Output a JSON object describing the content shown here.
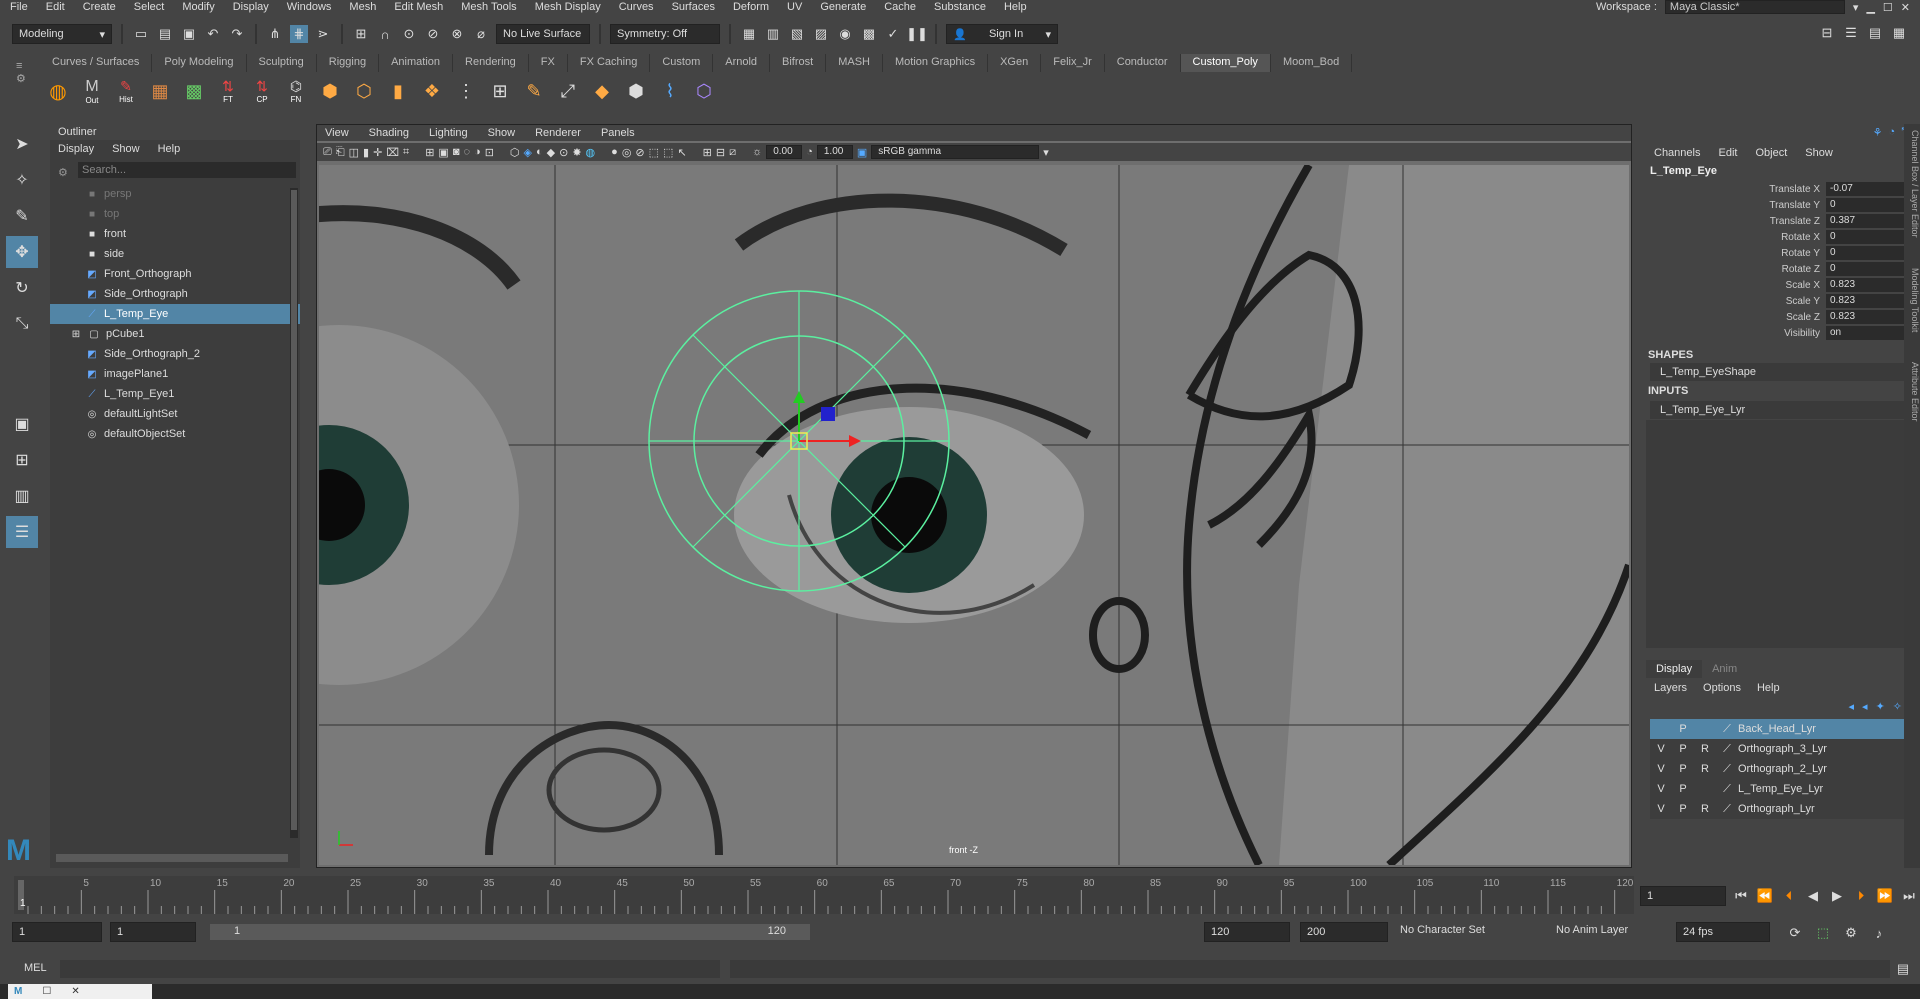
{
  "menubar": {
    "items": [
      "File",
      "Edit",
      "Create",
      "Select",
      "Modify",
      "Display",
      "Windows",
      "Mesh",
      "Edit Mesh",
      "Mesh Tools",
      "Mesh Display",
      "Curves",
      "Surfaces",
      "Deform",
      "UV",
      "Generate",
      "Cache",
      "Substance",
      "Help"
    ],
    "workspace_label": "Workspace :",
    "workspace_value": "Maya Classic*"
  },
  "statusline": {
    "mode": "Modeling",
    "live_surface": "No Live Surface",
    "symmetry": "Symmetry: Off",
    "sign_in": "Sign In"
  },
  "shelf": {
    "tabs": [
      "Curves / Surfaces",
      "Poly Modeling",
      "Sculpting",
      "Rigging",
      "Animation",
      "Rendering",
      "FX",
      "FX Caching",
      "Custom",
      "Arnold",
      "Bifrost",
      "MASH",
      "Motion Graphics",
      "XGen",
      "Felix_Jr",
      "Conductor",
      "Custom_Poly",
      "Moom_Bod"
    ],
    "active": "Custom_Poly",
    "icon_labels": [
      "",
      "Out",
      "Hist",
      "",
      "",
      "",
      "FT",
      "CP",
      "FN"
    ]
  },
  "outliner": {
    "title": "Outliner",
    "menus": [
      "Display",
      "Show",
      "Help"
    ],
    "search_placeholder": "Search...",
    "items": [
      {
        "label": "persp",
        "dim": true
      },
      {
        "label": "top",
        "dim": true
      },
      {
        "label": "front"
      },
      {
        "label": "side"
      },
      {
        "label": "Front_Orthograph"
      },
      {
        "label": "Side_Orthograph"
      },
      {
        "label": "L_Temp_Eye",
        "selected": true
      },
      {
        "label": "pCube1"
      },
      {
        "label": "Side_Orthograph_2"
      },
      {
        "label": "imagePlane1"
      },
      {
        "label": "L_Temp_Eye1"
      },
      {
        "label": "defaultLightSet"
      },
      {
        "label": "defaultObjectSet"
      }
    ]
  },
  "viewport": {
    "menus": [
      "View",
      "Shading",
      "Lighting",
      "Show",
      "Renderer",
      "Panels"
    ],
    "exposure": "0.00",
    "gamma": "1.00",
    "color_space": "sRGB gamma",
    "camera_label": "front -Z"
  },
  "channelbox": {
    "menus": [
      "Channels",
      "Edit",
      "Object",
      "Show"
    ],
    "object": "L_Temp_Eye",
    "channels": [
      {
        "name": "Translate X",
        "value": "-0.07"
      },
      {
        "name": "Translate Y",
        "value": "0"
      },
      {
        "name": "Translate Z",
        "value": "0.387"
      },
      {
        "name": "Rotate X",
        "value": "0"
      },
      {
        "name": "Rotate Y",
        "value": "0"
      },
      {
        "name": "Rotate Z",
        "value": "0"
      },
      {
        "name": "Scale X",
        "value": "0.823"
      },
      {
        "name": "Scale Y",
        "value": "0.823"
      },
      {
        "name": "Scale Z",
        "value": "0.823"
      },
      {
        "name": "Visibility",
        "value": "on"
      }
    ],
    "shapes_header": "SHAPES",
    "shape": "L_Temp_EyeShape",
    "inputs_header": "INPUTS",
    "input": "L_Temp_Eye_Lyr"
  },
  "layers": {
    "tabs": [
      "Display",
      "Anim"
    ],
    "menus": [
      "Layers",
      "Options",
      "Help"
    ],
    "rows": [
      {
        "v": "",
        "p": "P",
        "r": "",
        "name": "Back_Head_Lyr",
        "selected": true
      },
      {
        "v": "V",
        "p": "P",
        "r": "R",
        "name": "Orthograph_3_Lyr"
      },
      {
        "v": "V",
        "p": "P",
        "r": "R",
        "name": "Orthograph_2_Lyr"
      },
      {
        "v": "V",
        "p": "P",
        "r": "",
        "name": "L_Temp_Eye_Lyr"
      },
      {
        "v": "V",
        "p": "P",
        "r": "R",
        "name": "Orthograph_Lyr"
      }
    ]
  },
  "timeline": {
    "ticks": [
      "5",
      "10",
      "15",
      "20",
      "25",
      "30",
      "35",
      "40",
      "45",
      "50",
      "55",
      "60",
      "65",
      "70",
      "75",
      "80",
      "85",
      "90",
      "95",
      "100",
      "105",
      "110",
      "115",
      "120"
    ],
    "current_frame": "1",
    "first_tick": "1"
  },
  "range": {
    "start": "1",
    "playback_start": "1",
    "slider_start": "1",
    "slider_end": "120",
    "playback_end": "120",
    "end": "200",
    "character_set": "No Character Set",
    "anim_layer": "No Anim Layer",
    "fps": "24 fps"
  },
  "mel": {
    "label": "MEL"
  },
  "side_tabs": [
    "Channel Box / Layer Editor",
    "Modeling Toolkit",
    "Attribute Editor"
  ]
}
